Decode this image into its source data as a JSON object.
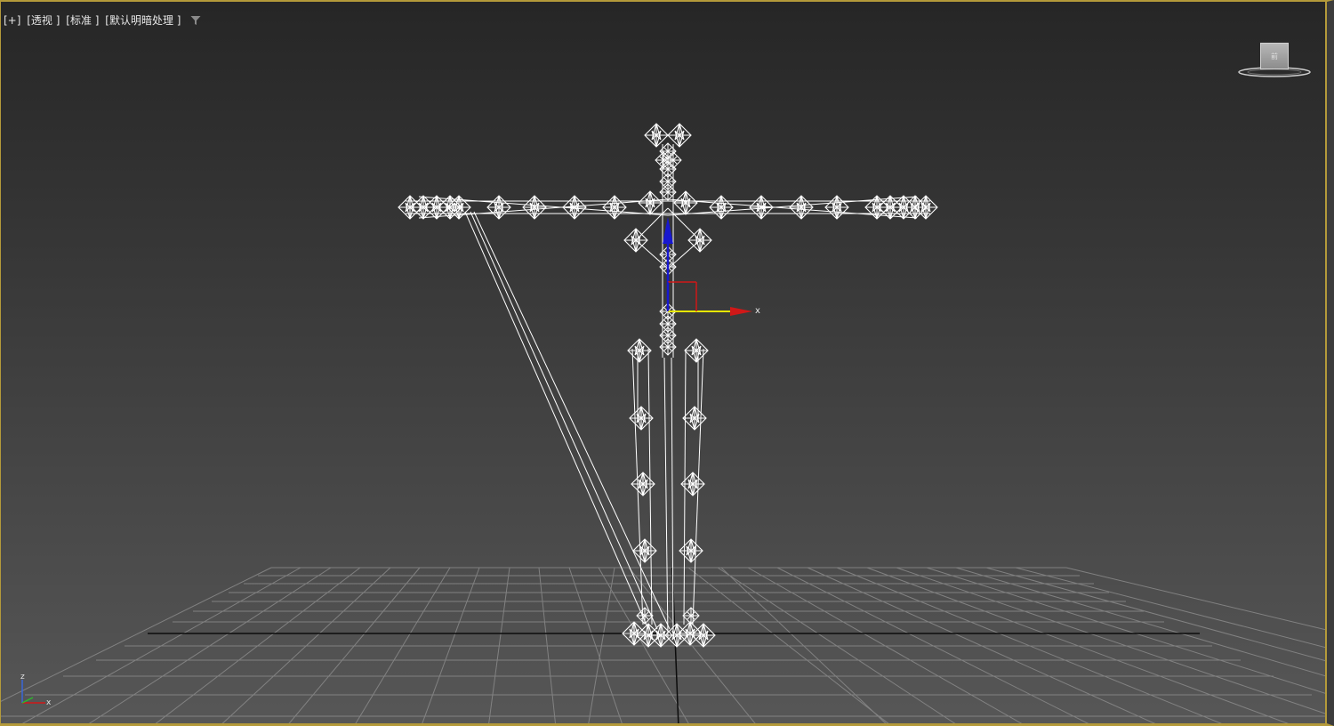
{
  "viewport": {
    "labels": {
      "plus": "[+]",
      "view": "[透视 ]",
      "shading": "[标准 ]",
      "lighting": "[默认明暗处理 ]"
    },
    "viewcube_face": "前",
    "gizmo_x_label": "x",
    "tripod": {
      "z_label": "z",
      "x_label": "x"
    },
    "colors": {
      "frame_border": "#b49a3a",
      "background_top": "#262626",
      "background_bottom": "#575757",
      "grid": "#8a8a8a",
      "bones": "#ffffff",
      "gizmo_x": "#d01818",
      "gizmo_y": "#e6e600",
      "gizmo_z": "#1818d0"
    },
    "icons": [
      "filter-icon",
      "viewcube",
      "axis-tripod",
      "move-gizmo"
    ]
  }
}
